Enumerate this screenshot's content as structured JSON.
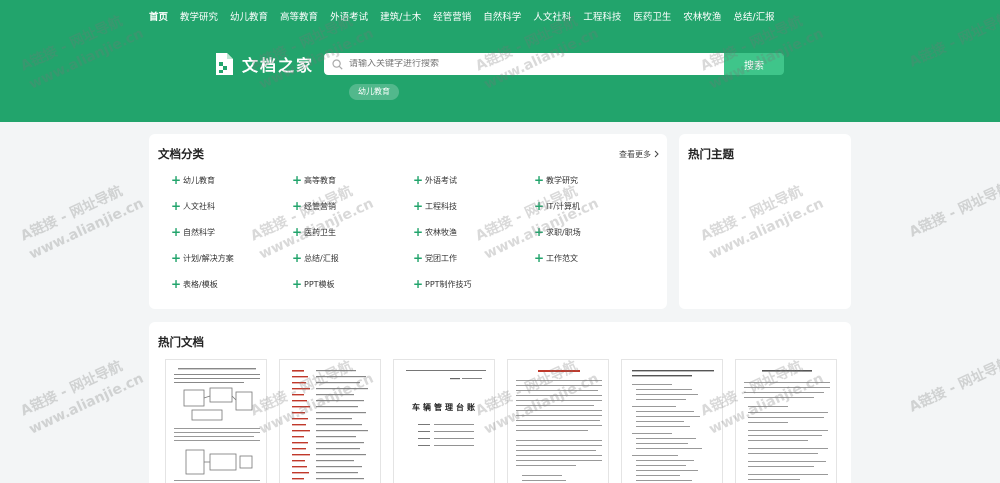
{
  "nav": [
    "首页",
    "教学研究",
    "幼儿教育",
    "高等教育",
    "外语考试",
    "建筑/土木",
    "经管营销",
    "自然科学",
    "人文社科",
    "工程科技",
    "医药卫生",
    "农林牧渔",
    "总结/汇报"
  ],
  "logo": "文档之家",
  "search": {
    "placeholder": "请输入关键字进行搜索",
    "button": "搜索"
  },
  "hot_tag": "幼儿教育",
  "categories": {
    "title": "文档分类",
    "more": "查看更多",
    "items": [
      "幼儿教育",
      "高等教育",
      "外语考试",
      "教学研究",
      "人文社科",
      "经管营销",
      "工程科技",
      "IT/计算机",
      "自然科学",
      "医药卫生",
      "农林牧渔",
      "求职/职场",
      "计划/解决方案",
      "总结/汇报",
      "党团工作",
      "工作范文",
      "表格/模板",
      "PPT模板",
      "PPT制作技巧"
    ]
  },
  "hot_topics": {
    "title": "热门主题"
  },
  "hot_docs": {
    "title": "热门文档",
    "docs": [
      {
        "heading": ""
      },
      {
        "heading": ""
      },
      {
        "heading": "车辆管理台账"
      },
      {
        "heading": ""
      },
      {
        "heading": ""
      },
      {
        "heading": ""
      }
    ]
  },
  "watermark": {
    "line1": "A链接 - 网址导航",
    "line2": "www.alianjie.cn"
  },
  "colors": {
    "brand": "#22a46c",
    "accent": "#3fc58a",
    "topic_underline": "#eb5f5f"
  }
}
